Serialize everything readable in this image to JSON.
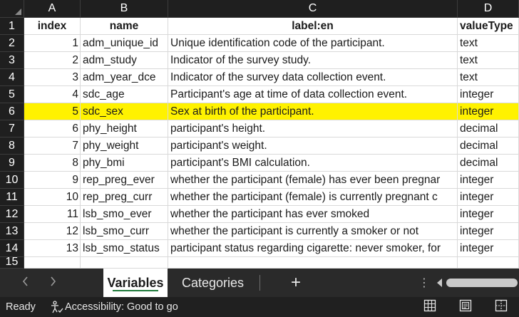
{
  "sheet": {
    "column_headers": [
      "A",
      "B",
      "C",
      "D"
    ],
    "row_numbers": [
      "1",
      "2",
      "3",
      "4",
      "5",
      "6",
      "7",
      "8",
      "9",
      "10",
      "11",
      "12",
      "13",
      "14",
      "15"
    ],
    "header_row": [
      "index",
      "name",
      "label:en",
      "valueType"
    ],
    "rows": [
      {
        "index": "1",
        "name": "adm_unique_id",
        "label": "Unique identification code of the participant.",
        "valueType": "text"
      },
      {
        "index": "2",
        "name": "adm_study",
        "label": "Indicator of the survey study.",
        "valueType": "text"
      },
      {
        "index": "3",
        "name": "adm_year_dce",
        "label": "Indicator of the survey data collection event.",
        "valueType": "text"
      },
      {
        "index": "4",
        "name": "sdc_age",
        "label": "Participant's age at time of data collection event.",
        "valueType": "integer"
      },
      {
        "index": "5",
        "name": "sdc_sex",
        "label": "Sex at birth of the participant.",
        "valueType": "integer"
      },
      {
        "index": "6",
        "name": "phy_height",
        "label": "participant's height.",
        "valueType": "decimal"
      },
      {
        "index": "7",
        "name": "phy_weight",
        "label": "participant's weight.",
        "valueType": "decimal"
      },
      {
        "index": "8",
        "name": "phy_bmi",
        "label": "participant's BMI calculation.",
        "valueType": "decimal"
      },
      {
        "index": "9",
        "name": "rep_preg_ever",
        "label": "whether the participant (female) has ever been pregnar",
        "valueType": "integer"
      },
      {
        "index": "10",
        "name": "rep_preg_curr",
        "label": "whether the participant (female) is currently pregnant c",
        "valueType": "integer"
      },
      {
        "index": "11",
        "name": "lsb_smo_ever",
        "label": "whether the participant has ever smoked",
        "valueType": "integer"
      },
      {
        "index": "12",
        "name": "lsb_smo_curr",
        "label": "whether the participant is currently a smoker or not",
        "valueType": "integer"
      },
      {
        "index": "13",
        "name": "lsb_smo_status",
        "label": "participant status regarding cigarette: never smoker, for",
        "valueType": "integer"
      }
    ],
    "highlight_color": "#fff200",
    "highlighted_row_index": "5"
  },
  "tabs": {
    "prev_icon": "chevron-left-icon",
    "next_icon": "chevron-right-icon",
    "sheets": [
      "Variables",
      "Categories"
    ],
    "active": "Variables",
    "add_label": "+",
    "more_label": "⋮"
  },
  "status": {
    "ready": "Ready",
    "accessibility": "Accessibility: Good to go",
    "view_icons": [
      "normal-view-icon",
      "page-layout-view-icon",
      "page-break-preview-icon"
    ]
  },
  "colors": {
    "header_bg": "#1f1f1f",
    "tabbar_bg": "#2a2a2a",
    "status_bg": "#202020",
    "active_tab_underline": "#1f7a3a"
  }
}
